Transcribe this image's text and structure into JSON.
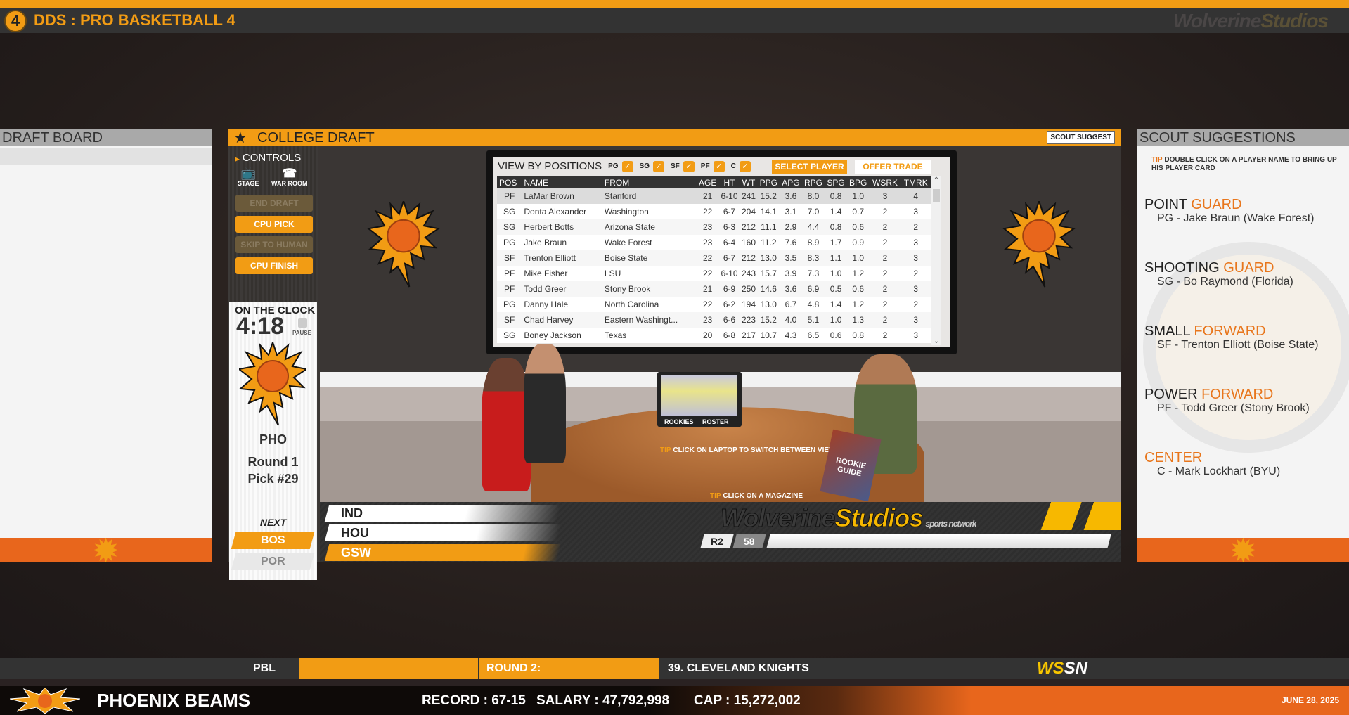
{
  "app": {
    "title": "DDS : PRO BASKETBALL 4",
    "logo_text": "4",
    "brand": "Wolverine",
    "brand2": "Studios"
  },
  "draft_board": {
    "title": "DRAFT BOARD"
  },
  "college_draft": {
    "title": "COLLEGE DRAFT",
    "scout_suggest_label": "SCOUT SUGGEST"
  },
  "controls": {
    "title": "CONTROLS",
    "stage_label": "STAGE",
    "war_room_label": "WAR ROOM",
    "buttons": [
      {
        "label": "END DRAFT",
        "enabled": false
      },
      {
        "label": "CPU PICK",
        "enabled": true
      },
      {
        "label": "SKIP TO HUMAN",
        "enabled": false
      },
      {
        "label": "CPU FINISH",
        "enabled": true
      }
    ]
  },
  "clock": {
    "title": "ON THE CLOCK",
    "time": "4:18",
    "pause_label": "PAUSE",
    "team": "PHO",
    "round": "Round 1",
    "pick": "Pick #29",
    "next_label": "NEXT",
    "next_teams": [
      "BOS",
      "POR"
    ]
  },
  "positions_filter": {
    "label": "VIEW BY POSITIONS",
    "positions": [
      {
        "label": "PG",
        "checked": true
      },
      {
        "label": "SG",
        "checked": true
      },
      {
        "label": "SF",
        "checked": true
      },
      {
        "label": "PF",
        "checked": true
      },
      {
        "label": "C",
        "checked": true
      }
    ]
  },
  "actions": {
    "select_player": "SELECT PLAYER",
    "offer_trade": "OFFER TRADE"
  },
  "table": {
    "columns": [
      "POS",
      "NAME",
      "FROM",
      "AGE",
      "HT",
      "WT",
      "PPG",
      "APG",
      "RPG",
      "SPG",
      "BPG",
      "WSRK",
      "TMRK"
    ],
    "rows": [
      [
        "PF",
        "LaMar Brown",
        "Stanford",
        "21",
        "6-10",
        "241",
        "15.2",
        "3.6",
        "8.0",
        "0.8",
        "1.0",
        "3",
        "4"
      ],
      [
        "SG",
        "Donta Alexander",
        "Washington",
        "22",
        "6-7",
        "204",
        "14.1",
        "3.1",
        "7.0",
        "1.4",
        "0.7",
        "2",
        "3"
      ],
      [
        "SG",
        "Herbert Botts",
        "Arizona State",
        "23",
        "6-3",
        "212",
        "11.1",
        "2.9",
        "4.4",
        "0.8",
        "0.6",
        "2",
        "2"
      ],
      [
        "PG",
        "Jake Braun",
        "Wake Forest",
        "23",
        "6-4",
        "160",
        "11.2",
        "7.6",
        "8.9",
        "1.7",
        "0.9",
        "2",
        "3"
      ],
      [
        "SF",
        "Trenton Elliott",
        "Boise State",
        "22",
        "6-7",
        "212",
        "13.0",
        "3.5",
        "8.3",
        "1.1",
        "1.0",
        "2",
        "3"
      ],
      [
        "PF",
        "Mike Fisher",
        "LSU",
        "22",
        "6-10",
        "243",
        "15.7",
        "3.9",
        "7.3",
        "1.0",
        "1.2",
        "2",
        "2"
      ],
      [
        "PF",
        "Todd Greer",
        "Stony Brook",
        "21",
        "6-9",
        "250",
        "14.6",
        "3.6",
        "6.9",
        "0.5",
        "0.6",
        "2",
        "3"
      ],
      [
        "PG",
        "Danny Hale",
        "North Carolina",
        "22",
        "6-2",
        "194",
        "13.0",
        "6.7",
        "4.8",
        "1.4",
        "1.2",
        "2",
        "2"
      ],
      [
        "SF",
        "Chad Harvey",
        "Eastern Washingt...",
        "23",
        "6-6",
        "223",
        "15.2",
        "4.0",
        "5.1",
        "1.0",
        "1.3",
        "2",
        "3"
      ],
      [
        "SG",
        "Boney Jackson",
        "Texas",
        "20",
        "6-8",
        "217",
        "10.7",
        "4.3",
        "6.5",
        "0.6",
        "0.8",
        "2",
        "3"
      ]
    ]
  },
  "scene": {
    "laptop_labels": [
      "ROOKIES",
      "ROSTER"
    ],
    "tip_word": "TIP",
    "tip_laptop": "CLICK ON LAPTOP TO SWITCH BETWEEN VIEWS",
    "tip_magazine": "CLICK ON A MAGAZINE",
    "magazine_title": "ROOKIE GUIDE"
  },
  "ticker": {
    "teams": [
      "IND",
      "HOU",
      "GSW"
    ],
    "brand": "Wolverine",
    "brand2": "Studios",
    "brand3": "sports network",
    "round": "R2",
    "pick": "58"
  },
  "scout": {
    "title": "SCOUT SUGGESTIONS",
    "tip_word": "TIP",
    "tip": "DOUBLE CLICK ON A PLAYER NAME TO BRING UP HIS PLAYER CARD",
    "suggestions": [
      {
        "pos1": "POINT",
        "pos2": "GUARD",
        "player": "PG - Jake Braun (Wake Forest)"
      },
      {
        "pos1": "SHOOTING",
        "pos2": "GUARD",
        "player": "SG - Bo Raymond (Florida)"
      },
      {
        "pos1": "SMALL",
        "pos2": "FORWARD",
        "player": "SF - Trenton Elliott (Boise State)"
      },
      {
        "pos1": "POWER",
        "pos2": "FORWARD",
        "player": "PF - Todd Greer (Stony Brook)"
      },
      {
        "pos1": "",
        "pos2": "CENTER",
        "player": "C - Mark Lockhart (BYU)"
      }
    ]
  },
  "status_bar": {
    "league": "PBL",
    "round": "ROUND 2:",
    "pick_team": "39. CLEVELAND KNIGHTS",
    "network": "WS",
    "network2": "SN"
  },
  "team_bar": {
    "team": "PHOENIX BEAMS",
    "record": "RECORD : 67-15",
    "salary": "SALARY : 47,792,998",
    "cap": "CAP : 15,272,002",
    "date": "JUNE 28, 2025"
  },
  "colors": {
    "accent": "#f29c14",
    "orange": "#e8661c",
    "dark": "#333333"
  }
}
